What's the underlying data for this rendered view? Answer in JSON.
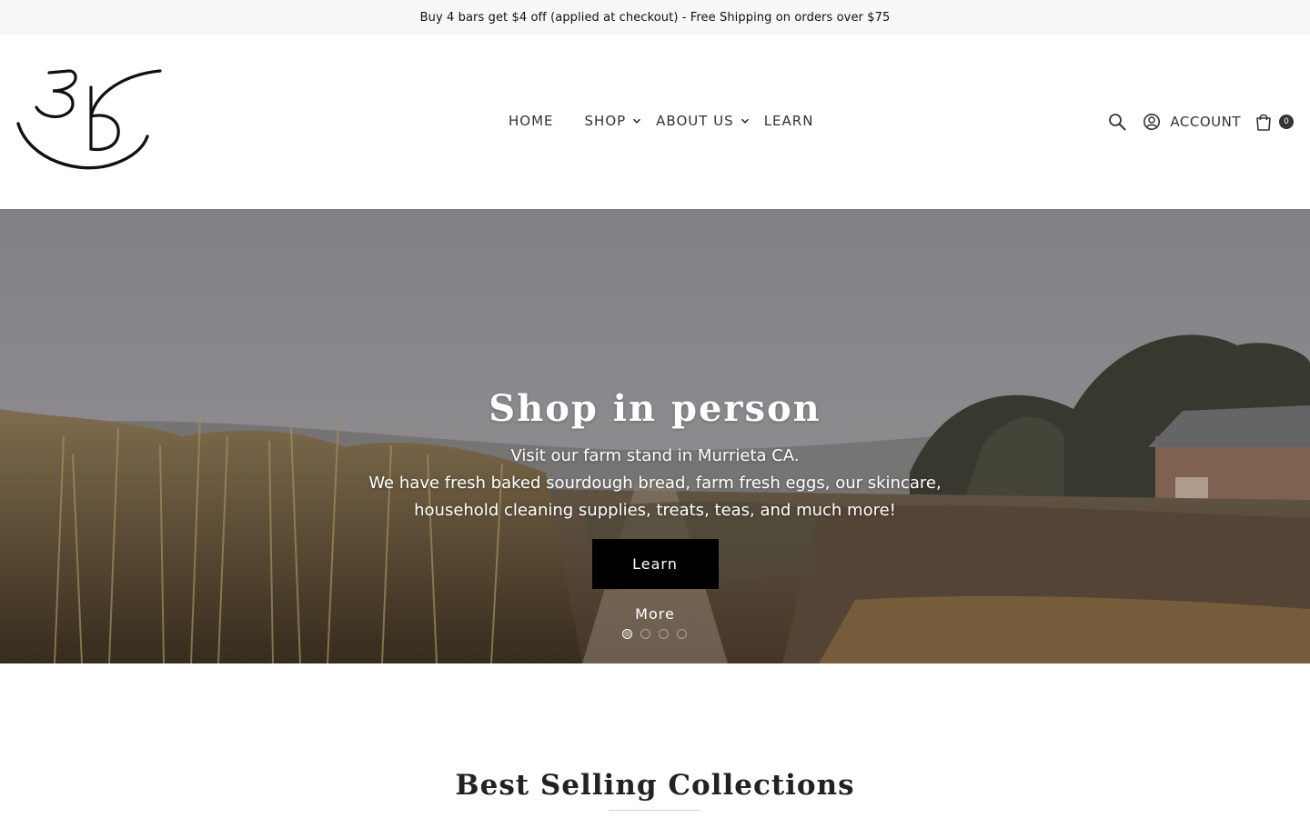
{
  "announcement": {
    "text": "Buy 4 bars get $4 off (applied at checkout) - Free Shipping on orders over $75"
  },
  "header": {
    "logo_alt": "3K",
    "nav": [
      {
        "label": "HOME",
        "has_dropdown": false
      },
      {
        "label": "SHOP",
        "has_dropdown": true
      },
      {
        "label": "ABOUT US",
        "has_dropdown": true
      },
      {
        "label": "LEARN",
        "has_dropdown": false
      }
    ],
    "account_label": "ACCOUNT",
    "cart_count": "0"
  },
  "hero": {
    "title": "Shop in person",
    "lines": [
      "Visit our farm stand in Murrieta CA.",
      "We have fresh baked sourdough bread, farm fresh eggs, our skincare,",
      "household cleaning supplies, treats, teas, and much more!"
    ],
    "cta_label": "Learn More",
    "slides_count": 4,
    "active_slide": 1
  },
  "section": {
    "title": "Best Selling Collections"
  },
  "colors": {
    "announcement_bg": "#f7f7f7",
    "cta_bg": "#000000",
    "text": "#333333"
  },
  "icons": [
    "search-icon",
    "account-icon",
    "cart-icon",
    "chevron-down-icon"
  ]
}
